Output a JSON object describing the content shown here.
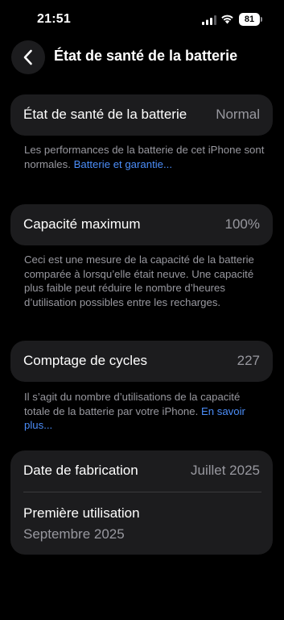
{
  "status_bar": {
    "time": "21:51",
    "battery_level": "81"
  },
  "nav": {
    "title": "État de santé de la batterie"
  },
  "battery_health": {
    "label": "État de santé de la batterie",
    "value": "Normal"
  },
  "health_note": {
    "text": "Les performances de la batterie de cet iPhone sont normales. ",
    "link": "Batterie et garantie..."
  },
  "max_capacity": {
    "label": "Capacité maximum",
    "value": "100%"
  },
  "capacity_note": {
    "text": "Ceci est une mesure de la capacité de la batterie comparée à lorsqu’elle était neuve. Une capacité plus faible peut réduire le nombre d’heures d’utilisation possibles entre les recharges."
  },
  "cycle_count": {
    "label": "Comptage de cycles",
    "value": "227"
  },
  "cycle_note": {
    "text": "Il s’agit du nombre d’utilisations de la capacité totale de la batterie par votre iPhone. ",
    "link": "En savoir plus..."
  },
  "dates": {
    "manufacture_label": "Date de fabrication",
    "manufacture_value": "Juillet 2025",
    "first_use_label": "Première utilisation",
    "first_use_value": "Septembre 2025"
  },
  "colors": {
    "background": "#000000",
    "card": "#1c1c1e",
    "secondary_text": "#98989f",
    "link": "#4b8df8"
  }
}
